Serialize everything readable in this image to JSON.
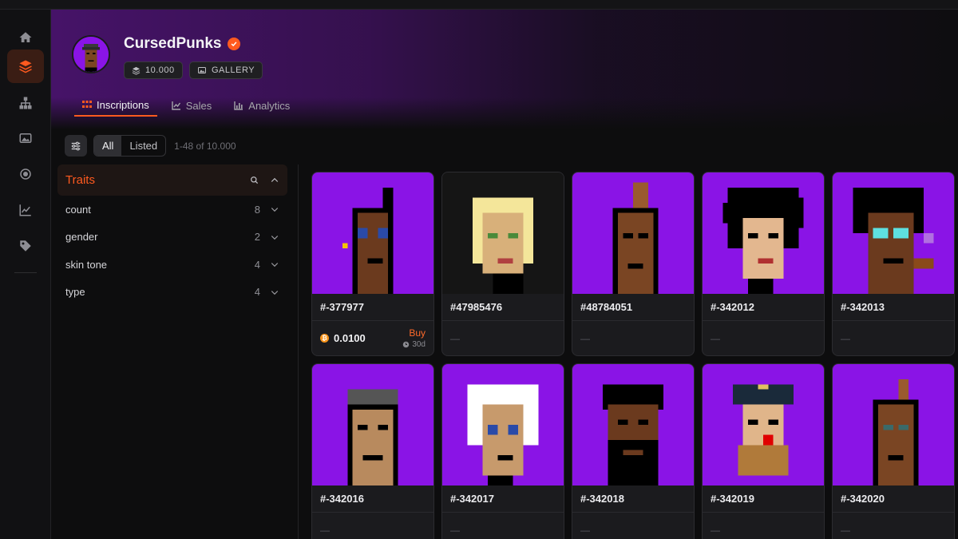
{
  "collection": {
    "name": "CursedPunks",
    "supply": "10.000",
    "gallery_label": "GALLERY"
  },
  "tabs": [
    {
      "label": "Inscriptions",
      "icon": "grid-icon"
    },
    {
      "label": "Sales",
      "icon": "line-chart-icon"
    },
    {
      "label": "Analytics",
      "icon": "bar-chart-icon"
    }
  ],
  "filters": {
    "all_label": "All",
    "listed_label": "Listed",
    "range_text": "1-48 of 10.000"
  },
  "traits": {
    "title": "Traits",
    "items": [
      {
        "label": "count",
        "count": "8"
      },
      {
        "label": "gender",
        "count": "2"
      },
      {
        "label": "skin tone",
        "count": "4"
      },
      {
        "label": "type",
        "count": "4"
      }
    ]
  },
  "sidebar": {
    "items": [
      "home-icon",
      "layers-icon",
      "hierarchy-icon",
      "image-icon",
      "record-icon",
      "chart-icon",
      "tag-icon"
    ]
  },
  "cards": [
    {
      "id": "#-377977",
      "price": "0.0100",
      "buy_label": "Buy",
      "age": "30d",
      "bg": "#8a14e6",
      "skin": "#6b3a1e"
    },
    {
      "id": "#47985476",
      "footer": "—",
      "bg": "#151515",
      "skin": "#d8b07a"
    },
    {
      "id": "#48784051",
      "footer": "—",
      "bg": "#8a14e6",
      "skin": "#7a4523"
    },
    {
      "id": "#-342012",
      "footer": "—",
      "bg": "#8a14e6",
      "skin": "#e3b78f"
    },
    {
      "id": "#-342013",
      "footer": "—",
      "bg": "#8a14e6",
      "skin": "#6b3a1e"
    },
    {
      "id": "#-342016",
      "footer": "—",
      "bg": "#8a14e6",
      "skin": "#b88a5e"
    },
    {
      "id": "#-342017",
      "footer": "—",
      "bg": "#8a14e6",
      "skin": "#c79a6c"
    },
    {
      "id": "#-342018",
      "footer": "—",
      "bg": "#8a14e6",
      "skin": "#6b3a1e"
    },
    {
      "id": "#-342019",
      "footer": "—",
      "bg": "#8a14e6",
      "skin": "#e0b58a"
    },
    {
      "id": "#-342020",
      "footer": "—",
      "bg": "#8a14e6",
      "skin": "#7a4523"
    }
  ],
  "colors": {
    "accent": "#ff5a1f",
    "card_bg": "#1b1b1e",
    "punk_purple": "#8a14e6"
  }
}
